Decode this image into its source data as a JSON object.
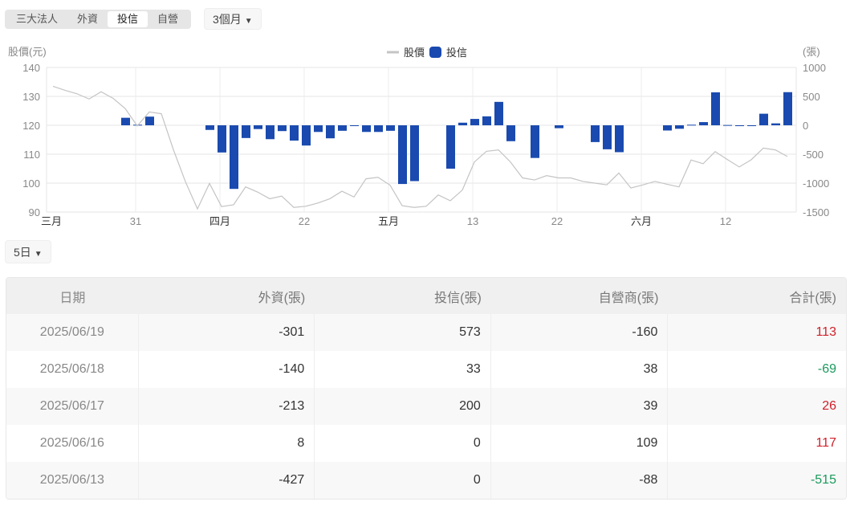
{
  "tabs": [
    {
      "label": "三大法人",
      "active": false
    },
    {
      "label": "外資",
      "active": false
    },
    {
      "label": "投信",
      "active": true
    },
    {
      "label": "自營",
      "active": false
    }
  ],
  "range_select": {
    "value": "3個月",
    "icon": "triangle-down-icon"
  },
  "days_select": {
    "value": "5日",
    "icon": "triangle-down-icon"
  },
  "colors": {
    "bar": "#1a4aaf",
    "line": "#c4c4c4",
    "up": "#d0202a",
    "down": "#1a9a5c"
  },
  "chart_data": {
    "type": "bar+line",
    "left_axis_label": "股價(元)",
    "right_axis_label": "(張)",
    "legend": [
      "股價",
      "投信"
    ],
    "left_ylim": [
      90,
      140
    ],
    "left_ticks": [
      "140",
      "130",
      "120",
      "110",
      "100",
      "90"
    ],
    "right_ylim": [
      -1500,
      1000
    ],
    "right_ticks": [
      "1000",
      "500",
      "0",
      "-500",
      "-1000",
      "-1500"
    ],
    "x_ticks": [
      {
        "index": 0,
        "label": "三月"
      },
      {
        "index": 7,
        "label": "31"
      },
      {
        "index": 14,
        "label": "四月"
      },
      {
        "index": 21,
        "label": "22"
      },
      {
        "index": 28,
        "label": "五月"
      },
      {
        "index": 35,
        "label": "13"
      },
      {
        "index": 42,
        "label": "22"
      },
      {
        "index": 49,
        "label": "六月"
      },
      {
        "index": 56,
        "label": "12"
      }
    ],
    "price": [
      133.5,
      132.1,
      130.9,
      129.1,
      131.6,
      129.3,
      125.8,
      119.8,
      124.6,
      124.0,
      111.6,
      100.5,
      91.1,
      99.9,
      91.9,
      92.5,
      98.7,
      96.9,
      94.6,
      95.5,
      91.6,
      92.0,
      93.1,
      94.6,
      97.2,
      95.2,
      101.5,
      102.0,
      99.3,
      92.2,
      91.6,
      92.0,
      95.9,
      93.9,
      97.6,
      107.3,
      111.0,
      111.5,
      107.3,
      101.8,
      101.1,
      102.6,
      101.8,
      101.8,
      100.6,
      100.0,
      99.4,
      103.5,
      98.3,
      99.4,
      100.6,
      99.6,
      98.7,
      108.0,
      106.7,
      110.9,
      108.2,
      105.6,
      108.1,
      112.1,
      111.5,
      109.2
    ],
    "trust_net": [
      null,
      null,
      null,
      null,
      null,
      null,
      130,
      10,
      150,
      null,
      null,
      null,
      null,
      -80,
      -470,
      -1100,
      -220,
      -65,
      -240,
      -100,
      -265,
      -350,
      -115,
      -225,
      -95,
      -10,
      -115,
      -115,
      -95,
      -1015,
      -965,
      null,
      null,
      -750,
      45,
      110,
      155,
      405,
      -275,
      null,
      -565,
      null,
      -50,
      null,
      null,
      -290,
      -415,
      -465,
      null,
      null,
      null,
      -90,
      -60,
      10,
      55,
      570,
      5,
      0,
      0,
      200,
      33,
      573
    ]
  },
  "table": {
    "headers": [
      "日期",
      "外資(張)",
      "投信(張)",
      "自營商(張)",
      "合計(張)"
    ],
    "rows": [
      [
        "2025/06/19",
        "-301",
        "573",
        "-160",
        "113"
      ],
      [
        "2025/06/18",
        "-140",
        "33",
        "38",
        "-69"
      ],
      [
        "2025/06/17",
        "-213",
        "200",
        "39",
        "26"
      ],
      [
        "2025/06/16",
        "8",
        "0",
        "109",
        "117"
      ],
      [
        "2025/06/13",
        "-427",
        "0",
        "-88",
        "-515"
      ]
    ]
  }
}
